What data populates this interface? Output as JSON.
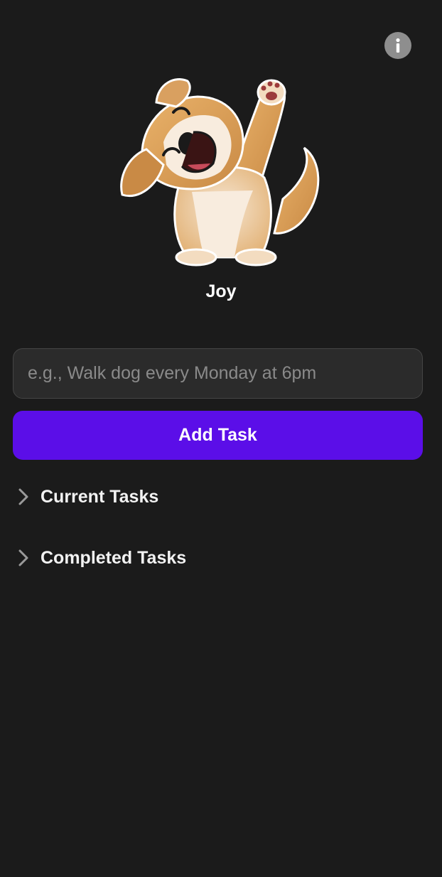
{
  "header": {
    "info_icon": "info-icon"
  },
  "mascot": {
    "name": "Joy",
    "image": "dancing-dog-illustration"
  },
  "task_input": {
    "placeholder": "e.g., Walk dog every Monday at 6pm",
    "value": ""
  },
  "add_button": {
    "label": "Add Task",
    "color": "#5b0ee8"
  },
  "sections": {
    "current": {
      "label": "Current Tasks",
      "icon": "chevron-right-icon",
      "expanded": false
    },
    "completed": {
      "label": "Completed Tasks",
      "icon": "chevron-right-icon",
      "expanded": false
    }
  },
  "colors": {
    "background": "#1b1b1b",
    "input_background": "#2b2b2b",
    "accent": "#5b0ee8"
  }
}
